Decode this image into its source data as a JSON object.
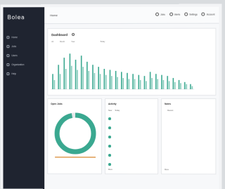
{
  "app": {
    "brand": "Bolea",
    "brand_sub": ""
  },
  "sidebar": {
    "items": [
      {
        "label": "Home"
      },
      {
        "label": "Jobs"
      },
      {
        "label": "Users"
      },
      {
        "label": "Organization"
      },
      {
        "label": "Help"
      }
    ]
  },
  "topbar": {
    "title": "Home",
    "actions": [
      {
        "label": "Jobs",
        "icon": "clock-icon"
      },
      {
        "label": "Alerts",
        "icon": "bell-icon"
      },
      {
        "label": "Settings",
        "icon": "gear-icon"
      },
      {
        "label": "Account",
        "icon": "user-icon"
      }
    ]
  },
  "chart_section": {
    "title": "Dashboard",
    "filters": [
      "All",
      "Month",
      "Year",
      "",
      "",
      "",
      "Today"
    ],
    "legend": [
      "",
      "",
      "",
      "",
      ""
    ]
  },
  "chart_data": {
    "type": "bar",
    "title": "Dashboard",
    "categories": [
      "1",
      "2",
      "3",
      "4",
      "5",
      "6",
      "7",
      "8",
      "9",
      "10",
      "11",
      "12",
      "13",
      "14",
      "15",
      "16",
      "17",
      "18",
      "19",
      "20",
      "21",
      "22",
      "23",
      "24",
      "25"
    ],
    "series": [
      {
        "values": [
          30,
          48,
          62,
          70,
          58,
          66,
          54,
          48,
          44,
          40,
          38,
          36,
          34,
          32,
          30,
          28,
          26,
          34,
          30,
          28,
          26,
          22,
          18,
          14,
          10
        ]
      },
      {
        "values": [
          18,
          30,
          40,
          46,
          38,
          44,
          36,
          32,
          30,
          28,
          26,
          24,
          22,
          20,
          20,
          18,
          16,
          22,
          20,
          18,
          16,
          14,
          12,
          10,
          6
        ]
      }
    ],
    "colors": [
      "#3aa890",
      "#7fc9b8"
    ],
    "ylim": [
      0,
      80
    ],
    "grid": false
  },
  "donut": {
    "title": "Open Jobs",
    "center": "",
    "value_fraction": 0.97,
    "color": "#3aa890",
    "stats": [
      "",
      "",
      "",
      ""
    ]
  },
  "activity": {
    "title": "Activity",
    "sub": [
      "New",
      "Today"
    ],
    "items": [
      {
        "title": "",
        "sub": ""
      },
      {
        "title": "",
        "sub": ""
      },
      {
        "title": "",
        "sub": ""
      },
      {
        "title": "",
        "sub": ""
      },
      {
        "title": "",
        "sub": ""
      },
      {
        "title": "",
        "sub": ""
      }
    ],
    "more": "More"
  },
  "notes": {
    "title": "Notes",
    "sub": [
      "",
      "Recent"
    ],
    "items": [
      {
        "title": "",
        "sub": ""
      },
      {
        "title": "",
        "sub": ""
      },
      {
        "title": "",
        "sub": ""
      },
      {
        "title": "",
        "sub": ""
      },
      {
        "title": "",
        "sub": ""
      },
      {
        "title": "",
        "sub": ""
      }
    ],
    "more": "More"
  },
  "footer": ""
}
